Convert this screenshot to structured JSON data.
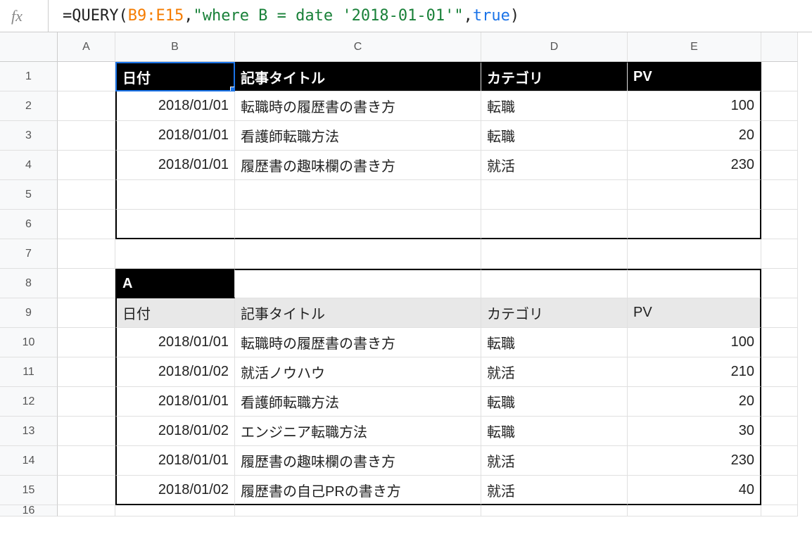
{
  "formula_bar": {
    "fx_label": "fx",
    "eq": "=",
    "func": "QUERY",
    "open": "(",
    "range": "B9:E15",
    "comma1": ",",
    "str": "\"where B = date '2018-01-01'\"",
    "comma2": ",",
    "bool": "true",
    "close": ")"
  },
  "columns": [
    "A",
    "B",
    "C",
    "D",
    "E"
  ],
  "rows": [
    "1",
    "2",
    "3",
    "4",
    "5",
    "6",
    "7",
    "8",
    "9",
    "10",
    "11",
    "12",
    "13",
    "14",
    "15",
    "16"
  ],
  "result_headers": {
    "date": "日付",
    "title": "記事タイトル",
    "category": "カテゴリ",
    "pv": "PV"
  },
  "result_rows": [
    {
      "date": "2018/01/01",
      "title": "転職時の履歴書の書き方",
      "category": "転職",
      "pv": "100"
    },
    {
      "date": "2018/01/01",
      "title": "看護師転職方法",
      "category": "転職",
      "pv": "20"
    },
    {
      "date": "2018/01/01",
      "title": "履歴書の趣味欄の書き方",
      "category": "就活",
      "pv": "230"
    }
  ],
  "source_label": "A",
  "source_headers": {
    "date": "日付",
    "title": "記事タイトル",
    "category": "カテゴリ",
    "pv": "PV"
  },
  "source_rows": [
    {
      "date": "2018/01/01",
      "title": "転職時の履歴書の書き方",
      "category": "転職",
      "pv": "100"
    },
    {
      "date": "2018/01/02",
      "title": "就活ノウハウ",
      "category": "就活",
      "pv": "210"
    },
    {
      "date": "2018/01/01",
      "title": "看護師転職方法",
      "category": "転職",
      "pv": "20"
    },
    {
      "date": "2018/01/02",
      "title": "エンジニア転職方法",
      "category": "転職",
      "pv": "30"
    },
    {
      "date": "2018/01/01",
      "title": "履歴書の趣味欄の書き方",
      "category": "就活",
      "pv": "230"
    },
    {
      "date": "2018/01/02",
      "title": "履歴書の自己PRの書き方",
      "category": "就活",
      "pv": "40"
    }
  ]
}
